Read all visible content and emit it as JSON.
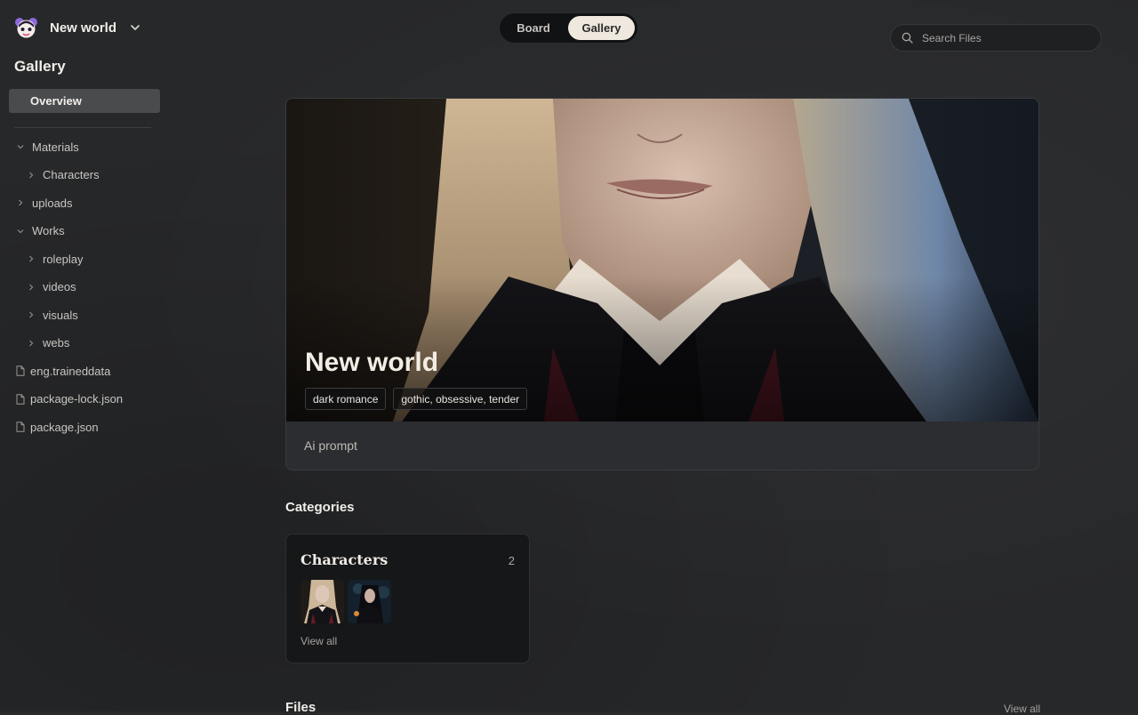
{
  "workspace": {
    "name": "New world"
  },
  "sidebar": {
    "title": "Gallery",
    "overview": "Overview",
    "tree": [
      {
        "label": "Materials",
        "type": "folder",
        "expanded": true,
        "level": 0
      },
      {
        "label": "Characters",
        "type": "folder",
        "expanded": false,
        "level": 1
      },
      {
        "label": "uploads",
        "type": "folder",
        "expanded": false,
        "level": 0
      },
      {
        "label": "Works",
        "type": "folder",
        "expanded": true,
        "level": 0
      },
      {
        "label": "roleplay",
        "type": "folder",
        "expanded": false,
        "level": 1
      },
      {
        "label": "videos",
        "type": "folder",
        "expanded": false,
        "level": 1
      },
      {
        "label": "visuals",
        "type": "folder",
        "expanded": false,
        "level": 1
      },
      {
        "label": "webs",
        "type": "folder",
        "expanded": false,
        "level": 1
      },
      {
        "label": "eng.traineddata",
        "type": "file",
        "level": 0
      },
      {
        "label": "package-lock.json",
        "type": "file",
        "level": 0
      },
      {
        "label": "package.json",
        "type": "file",
        "level": 0
      }
    ]
  },
  "view_toggle": {
    "board": "Board",
    "gallery": "Gallery",
    "active": "Gallery"
  },
  "search": {
    "placeholder": "Search Files",
    "value": ""
  },
  "hero": {
    "title": "New world",
    "tags": [
      "dark romance",
      "gothic, obsessive, tender"
    ],
    "prompt": "Ai prompt"
  },
  "categories": {
    "heading": "Categories",
    "items": [
      {
        "name": "Characters",
        "count": "2",
        "view_all": "View all"
      }
    ]
  },
  "files": {
    "heading": "Files",
    "view_all": "View all"
  },
  "colors": {
    "background": "#27282a",
    "sidebar_active": "#4a4b4d",
    "toggle_active": "#efe8df",
    "card": "#161719"
  }
}
